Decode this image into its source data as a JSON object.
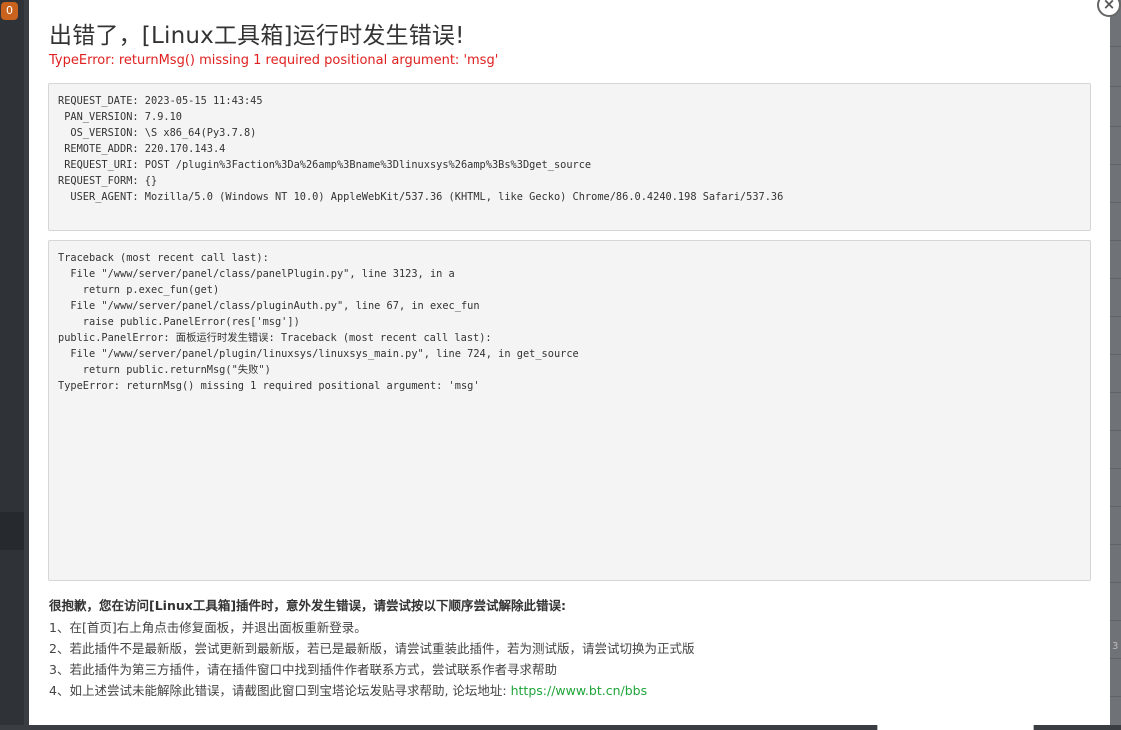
{
  "background": {
    "badge_count": "0",
    "right_edge_number": "3"
  },
  "dialog": {
    "close_glyph": "×",
    "title": "出错了，[Linux工具箱]运行时发生错误!",
    "error_message": "TypeError: returnMsg() missing 1 required positional argument: 'msg'",
    "request_info": "REQUEST_DATE: 2023-05-15 11:43:45\n PAN_VERSION: 7.9.10\n  OS_VERSION: \\S x86_64(Py3.7.8)\n REMOTE_ADDR: 220.170.143.4\n REQUEST_URI: POST /plugin%3Faction%3Da%26amp%3Bname%3Dlinuxsys%26amp%3Bs%3Dget_source\nREQUEST_FORM: {}\n  USER_AGENT: Mozilla/5.0 (Windows NT 10.0) AppleWebKit/537.36 (KHTML, like Gecko) Chrome/86.0.4240.198 Safari/537.36",
    "traceback": "Traceback (most recent call last):\n  File \"/www/server/panel/class/panelPlugin.py\", line 3123, in a\n    return p.exec_fun(get)\n  File \"/www/server/panel/class/pluginAuth.py\", line 67, in exec_fun\n    raise public.PanelError(res['msg'])\npublic.PanelError: 面板运行时发生错误: Traceback (most recent call last):\n  File \"/www/server/panel/plugin/linuxsys/linuxsys_main.py\", line 724, in get_source\n    return public.returnMsg(\"失败\")\nTypeError: returnMsg() missing 1 required positional argument: 'msg'",
    "help_heading": "很抱歉，您在访问[Linux工具箱]插件时，意外发生错误，请尝试按以下顺序尝试解除此错误:",
    "help_items": [
      "1、在[首页]右上角点击修复面板，并退出面板重新登录。",
      "2、若此插件不是最新版，尝试更新到最新版，若已是最新版，请尝试重装此插件，若为测试版，请尝试切换为正式版",
      "3、若此插件为第三方插件，请在插件窗口中找到插件作者联系方式，尝试联系作者寻求帮助"
    ],
    "help_item_4_prefix": "4、如上述尝试未能解除此错误，请截图此窗口到宝塔论坛发贴寻求帮助, 论坛地址: ",
    "forum_link": "https://www.bt.cn/bbs"
  },
  "colors": {
    "error_red": "#e02020",
    "link_green": "#20a53a",
    "overlay": "#3a3d42"
  }
}
